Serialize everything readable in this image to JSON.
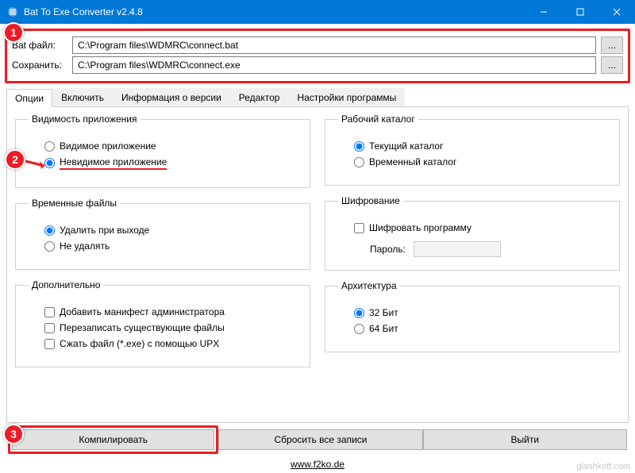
{
  "window": {
    "title": "Bat To Exe Converter v2.4.8"
  },
  "files": {
    "bat_label": "Bat файл:",
    "bat_value": "C:\\Program files\\WDMRC\\connect.bat",
    "save_label": "Сохранить:",
    "save_value": "C:\\Program files\\WDMRC\\connect.exe",
    "browse": "..."
  },
  "tabs": {
    "options": "Опции",
    "include": "Включить",
    "version": "Информация о версии",
    "editor": "Редактор",
    "settings": "Настройки программы"
  },
  "groups": {
    "visibility": {
      "legend": "Видимость приложения",
      "visible": "Видимое приложение",
      "invisible": "Невидимое приложение"
    },
    "tempfiles": {
      "legend": "Временные файлы",
      "delete_on_exit": "Удалить при выходе",
      "keep": "Не удалять"
    },
    "extra": {
      "legend": "Дополнительно",
      "admin": "Добавить манифест администратора",
      "overwrite": "Перезаписать существующие файлы",
      "upx": "Сжать файл (*.exe) с помощью UPX"
    },
    "workdir": {
      "legend": "Рабочий каталог",
      "current": "Текущий каталог",
      "temp": "Временный каталог"
    },
    "encrypt": {
      "legend": "Шифрование",
      "encrypt": "Шифровать программу",
      "pwd_label": "Пароль:"
    },
    "arch": {
      "legend": "Архитектура",
      "b32": "32 Бит",
      "b64": "64 Бит"
    }
  },
  "buttons": {
    "compile": "Компилировать",
    "reset": "Сбросить все записи",
    "exit": "Выйти"
  },
  "footer": {
    "link": "www.f2ko.de"
  },
  "watermark": "glashkoff.com",
  "badges": {
    "b1": "1",
    "b2": "2",
    "b3": "3"
  }
}
